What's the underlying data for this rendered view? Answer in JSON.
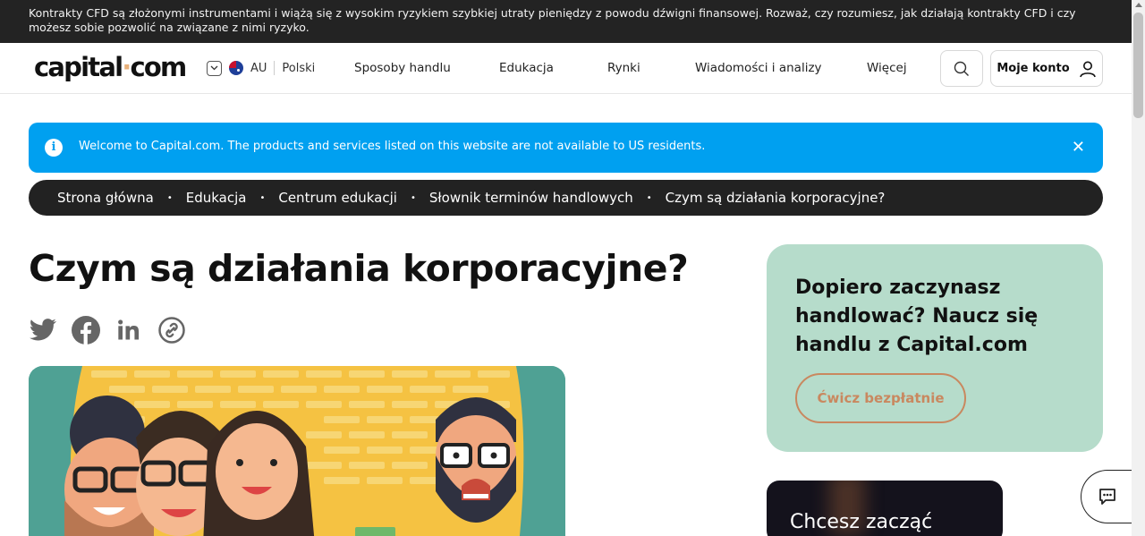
{
  "risk_warning": "Kontrakty CFD są złożonymi instrumentami i wiążą się z wysokim ryzykiem szybkiej utraty pieniędzy z powodu dźwigni finansowej. Rozważ, czy rozumiesz, jak działają kontrakty CFD i czy możesz sobie pozwolić na związane z nimi ryzyko.",
  "header": {
    "logo_left": "capital",
    "logo_dot": "·",
    "logo_right": "com",
    "region_code": "AU",
    "language": "Polski",
    "nav": [
      "Sposoby handlu",
      "Edukacja",
      "Rynki",
      "Wiadomości i analizy",
      "Więcej"
    ],
    "account_label": "Moje konto"
  },
  "banner": {
    "info_symbol": "i",
    "message": "Welcome to Capital.com. The products and services listed on this website are not available to US residents.",
    "close_symbol": "✕"
  },
  "breadcrumb": [
    "Strona główna",
    "Edukacja",
    "Centrum edukacji",
    "Słownik terminów handlowych",
    "Czym są działania korporacyjne?"
  ],
  "breadcrumb_separator": "•",
  "main": {
    "title": "Czym są działania korporacyjne?"
  },
  "sidebar": {
    "cta_heading": "Dopiero zaczynasz handlować? Naucz się handlu z Capital.com",
    "cta_button": "Ćwicz bezpłatnie",
    "promo_text": "Chcesz zacząć"
  },
  "colors": {
    "risk_bar": "#232323",
    "banner": "#00a0f0",
    "breadcrumb": "#222222",
    "cta_card": "#b6dccb",
    "cta_accent": "#c9885f",
    "logo_dot": "#e8b07a"
  }
}
